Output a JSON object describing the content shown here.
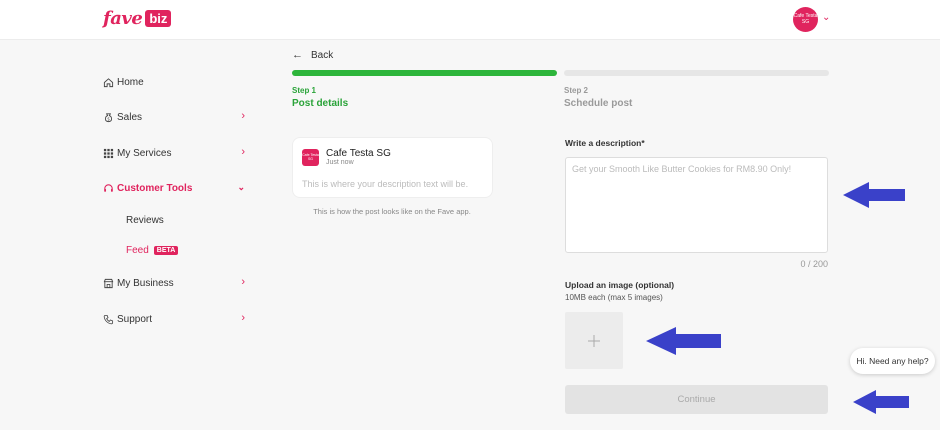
{
  "brand": {
    "name_part1": "fave",
    "name_part2": "biz",
    "accent_color": "#e0245e"
  },
  "header": {
    "avatar_text": "Cafe Testa SG"
  },
  "sidebar": {
    "items": [
      {
        "label": "Home",
        "icon": "home-icon"
      },
      {
        "label": "Sales",
        "icon": "money-bag-icon",
        "chevron": ">"
      },
      {
        "label": "My Services",
        "icon": "grid-icon",
        "chevron": ">"
      },
      {
        "label": "Customer Tools",
        "icon": "headset-icon",
        "chevron": "v",
        "active": true
      },
      {
        "label": "My Business",
        "icon": "store-icon",
        "chevron": ">"
      },
      {
        "label": "Support",
        "icon": "phone-icon",
        "chevron": ">"
      }
    ],
    "sub_items": [
      {
        "label": "Reviews"
      },
      {
        "label": "Feed",
        "badge": "BETA",
        "active": true
      }
    ]
  },
  "back": {
    "label": "Back"
  },
  "steps": [
    {
      "number": "Step 1",
      "title": "Post details",
      "status": "active",
      "color": "#2db53b"
    },
    {
      "number": "Step 2",
      "title": "Schedule post",
      "status": "pending"
    }
  ],
  "preview": {
    "merchant_name": "Cafe Testa SG",
    "time": "Just now",
    "placeholder_text": "This is where your description text will be.",
    "caption": "This is how the post looks like on the Fave app."
  },
  "form": {
    "description_label": "Write a description*",
    "description_value": "",
    "description_placeholder": "Get your Smooth Like Butter Cookies for RM8.90 Only!",
    "counter": "0 / 200",
    "upload_label": "Upload an image (optional)",
    "upload_hint": "10MB each (max 5 images)",
    "upload_icon": "plus-icon",
    "continue_label": "Continue"
  },
  "help": {
    "label": "Hi. Need any help?"
  },
  "annotation_color": "#3a41c9"
}
